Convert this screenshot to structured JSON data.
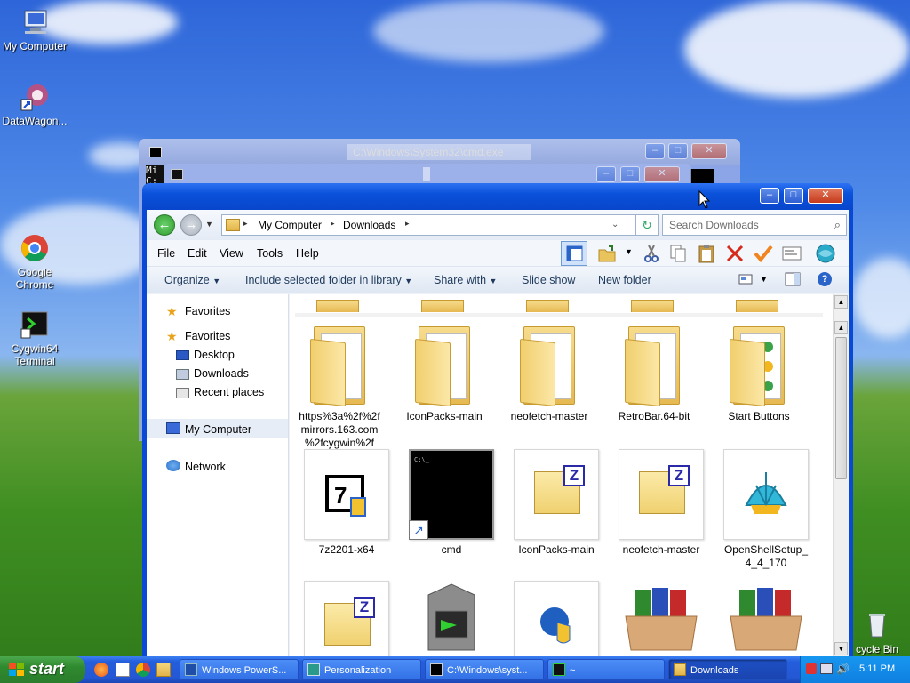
{
  "desktop": {
    "icons": [
      {
        "label": "My Computer"
      },
      {
        "label": "DataWagon..."
      },
      {
        "label": "Google Chrome"
      },
      {
        "label": "Cygwin64 Terminal"
      },
      {
        "label": "cycle Bin"
      }
    ]
  },
  "background_windows": {
    "console_title": "C:\\Windows\\System32\\cmd.exe",
    "console_text": "Mi\nC:"
  },
  "explorer": {
    "breadcrumb": [
      "My Computer",
      "Downloads"
    ],
    "search_placeholder": "Search Downloads",
    "menu": [
      "File",
      "Edit",
      "View",
      "Tools",
      "Help"
    ],
    "commands": [
      "Organize",
      "Include selected folder in library",
      "Share with",
      "Slide show",
      "New folder"
    ],
    "nav": {
      "favorites_top": "Favorites",
      "favorites": "Favorites",
      "desktop": "Desktop",
      "downloads": "Downloads",
      "recent": "Recent places",
      "computer": "My Computer",
      "network": "Network"
    },
    "row1": [
      {
        "label": "https%3a%2f%2f\nmirrors.163.com\n%2fcygwin%2f",
        "icon": "folder-icon"
      },
      {
        "label": "IconPacks-main",
        "icon": "folder-icon"
      },
      {
        "label": "neofetch-master",
        "icon": "folder-icon"
      },
      {
        "label": "RetroBar.64-bit",
        "icon": "folder-icon"
      },
      {
        "label": "Start Buttons",
        "icon": "folder-icon"
      }
    ],
    "row2": [
      {
        "label": "7z2201-x64",
        "icon": "7zip-installer-icon"
      },
      {
        "label": "cmd",
        "icon": "cmd-shortcut-icon"
      },
      {
        "label": "IconPacks-main",
        "icon": "zip-archive-icon"
      },
      {
        "label": "neofetch-master",
        "icon": "zip-archive-icon"
      },
      {
        "label": "OpenShellSetup_\n4_4_170",
        "icon": "openshell-installer-icon"
      }
    ]
  },
  "taskbar": {
    "start": "start",
    "tasks": [
      {
        "label": "Windows PowerS..."
      },
      {
        "label": "Personalization"
      },
      {
        "label": "C:\\Windows\\syst..."
      },
      {
        "label": "~"
      },
      {
        "label": "Downloads"
      }
    ],
    "clock": "5:11 PM"
  },
  "colors": {
    "xp_blue": "#0a48d6",
    "start_green": "#2f8a2f",
    "tray_blue": "#0f7fe0"
  }
}
